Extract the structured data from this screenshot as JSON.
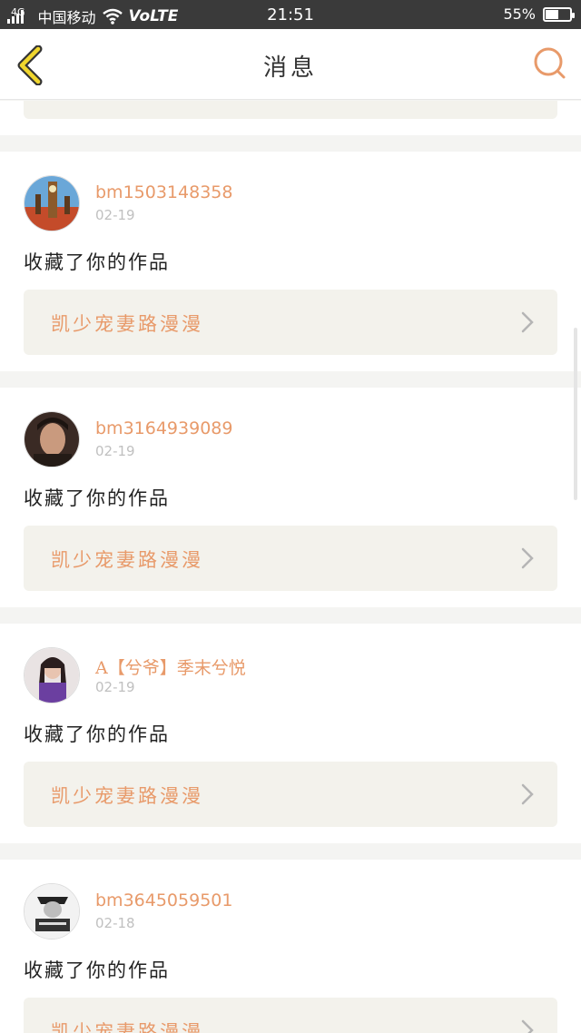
{
  "status": {
    "carrier": "中国移动",
    "network": "4G",
    "volte": "VoLTE",
    "time": "21:51",
    "battery_text": "55%",
    "battery_level": 0.55
  },
  "header": {
    "title": "消息",
    "back_icon": "back-chevron-icon",
    "search_icon": "search-icon",
    "accent_color": "#e89a6a"
  },
  "messages": [
    {
      "username": "bm1503148358",
      "date": "02-19",
      "action": "收藏了你的作品",
      "work_title": "凯少宠妻路漫漫"
    },
    {
      "username": "bm3164939089",
      "date": "02-19",
      "action": "收藏了你的作品",
      "work_title": "凯少宠妻路漫漫"
    },
    {
      "username": "A【兮爷】季末兮悦",
      "date": "02-19",
      "action": "收藏了你的作品",
      "work_title": "凯少宠妻路漫漫"
    },
    {
      "username": "bm3645059501",
      "date": "02-18",
      "action": "收藏了你的作品",
      "work_title": "凯少宠妻路漫漫"
    }
  ]
}
